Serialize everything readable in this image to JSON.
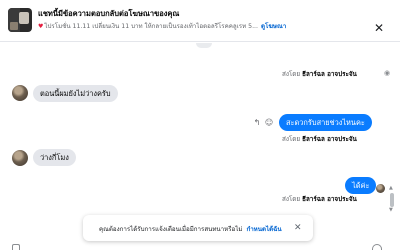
{
  "header": {
    "title": "แชทนี้มีข้อความตอบกลับต่อโฆษณาของคุณ",
    "subtitle": "ไปรโมชั่น 11.11 เปลี่ยนเงิน 11 บาท ให้กลายเป็นรองเท้าไอดอลรีโรคคลูเรท 5...",
    "subtitle_link": "ดูโฆษณา",
    "close_label": "✕"
  },
  "messages": {
    "sent_by_prefix": "ส่งโดย",
    "sender_name": "ธีลาร์ฉล อาจประจัน",
    "m1_in": "ตอนนี้ผมยังไม่ว่างครับ",
    "m2_out": "สะดวกรับสายช่วงไหนคะ",
    "m3_in": "ว่างกี่โมง",
    "m4_out": "ได้ค่ะ"
  },
  "toast": {
    "text": "คุณต้องการได้รับการแจ้งเตือนเมื่อมีการสนทนาหรือไม่",
    "link": "กำหนดได้ฉัน",
    "close_label": "✕"
  },
  "icons": {
    "close": "close-icon",
    "reply": "reply-icon",
    "emoji": "emoji-icon",
    "seen": "eye-icon"
  },
  "colors": {
    "accent": "#0a7cff",
    "incoming_bubble": "#e4e6eb",
    "link": "#0064d1"
  }
}
